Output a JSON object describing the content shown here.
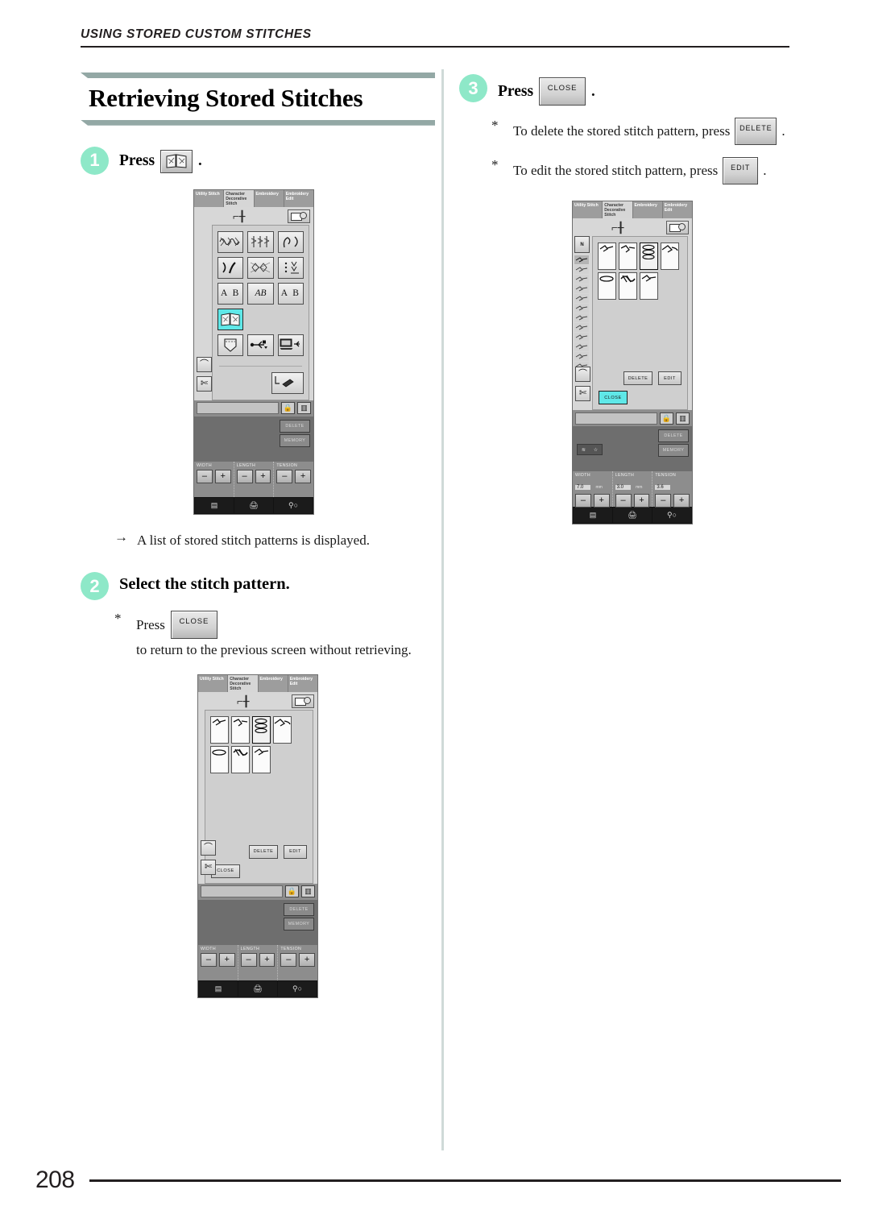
{
  "running_head": "USING STORED CUSTOM STITCHES",
  "page_number": "208",
  "section": {
    "title": "Retrieving Stored Stitches"
  },
  "colors": {
    "accent_step": "#8ee8c8",
    "rule_bar": "#93a8a5",
    "selected_key": "#5fe8e8",
    "text": "#231f20"
  },
  "steps": {
    "step1": {
      "number": "1",
      "label": "Press",
      "key_icon": "stored-stitch-retrieve-icon",
      "period": ".",
      "result_marker": "→",
      "result_text": "A list of stored stitch patterns is displayed."
    },
    "step2": {
      "number": "2",
      "title": "Select the stitch pattern.",
      "note_marker": "*",
      "note_before": "Press",
      "note_key": "CLOSE",
      "note_after": "to return to the previous screen without retrieving."
    },
    "step3": {
      "number": "3",
      "label": "Press",
      "key": "CLOSE",
      "period": ".",
      "notes": [
        {
          "marker": "*",
          "before": "To delete the stored stitch pattern, press",
          "key": "DELETE",
          "after": "."
        },
        {
          "marker": "*",
          "before": "To edit the stored stitch pattern, press",
          "key": "EDIT",
          "after": "."
        }
      ]
    }
  },
  "lcd": {
    "tabs": [
      {
        "label": "Utility Stitch",
        "active": false
      },
      {
        "label": "Character Decorative Stitch",
        "active": true
      },
      {
        "label": "Embroidery",
        "active": false
      },
      {
        "label": "Embroidery Edit",
        "active": false
      }
    ],
    "screen1": {
      "name": "character-decorative-stitch-category-screen",
      "keys": [
        {
          "name": "decorative-stitch-1",
          "kind": "pattern",
          "selected": false
        },
        {
          "name": "decorative-stitch-2",
          "kind": "pattern",
          "selected": false
        },
        {
          "name": "satin-stitch",
          "kind": "pattern",
          "selected": false
        },
        {
          "name": "cross-stitch",
          "kind": "pattern",
          "selected": false
        },
        {
          "name": "decorative-stitch-3",
          "kind": "pattern",
          "selected": false
        },
        {
          "name": "utility-decorative-stitch",
          "kind": "pattern",
          "selected": false
        },
        {
          "name": "font-gothic",
          "kind": "text",
          "text": "A B",
          "selected": false
        },
        {
          "name": "font-script",
          "kind": "text-italic",
          "text": "AB",
          "selected": false
        },
        {
          "name": "font-outline",
          "kind": "text-outline",
          "text": "A B",
          "selected": false
        },
        {
          "name": "my-custom-stitch-retrieve",
          "kind": "book",
          "selected": true
        },
        {
          "name": "pocket-stitch",
          "kind": "pocket",
          "selected": false
        },
        {
          "name": "usb-media",
          "kind": "usb",
          "selected": false
        },
        {
          "name": "computer-transfer",
          "kind": "computer",
          "selected": false
        }
      ],
      "bottom_key": "my-custom-stitch-designer"
    },
    "screen2": {
      "name": "stored-stitch-list-screen",
      "patterns": 7,
      "selected_index": 2,
      "buttons": {
        "delete": "DELETE",
        "edit": "EDIT",
        "close": "CLOSE"
      },
      "close_highlighted": false
    },
    "screen3": {
      "name": "stored-stitch-list-screen-close-highlighted",
      "patterns": 7,
      "selected_index": 2,
      "buttons": {
        "delete": "DELETE",
        "edit": "EDIT",
        "close": "CLOSE"
      },
      "close_highlighted": true,
      "thumb_rail_count": 13,
      "presser_foot": "N"
    },
    "lower_panel": {
      "delete_label": "DELETE",
      "memory_label": "MEMORY",
      "params": [
        {
          "label": "WIDTH",
          "value": "7.0",
          "unit": "mm"
        },
        {
          "label": "LENGTH",
          "value": "3.0",
          "unit": "mm"
        },
        {
          "label": "TENSION",
          "value": "3.6",
          "unit": ""
        }
      ],
      "params_blank": [
        {
          "label": "WIDTH",
          "value": "",
          "unit": ""
        },
        {
          "label": "LENGTH",
          "value": "",
          "unit": ""
        },
        {
          "label": "TENSION",
          "value": "",
          "unit": ""
        }
      ],
      "minus": "–",
      "plus": "+"
    }
  }
}
